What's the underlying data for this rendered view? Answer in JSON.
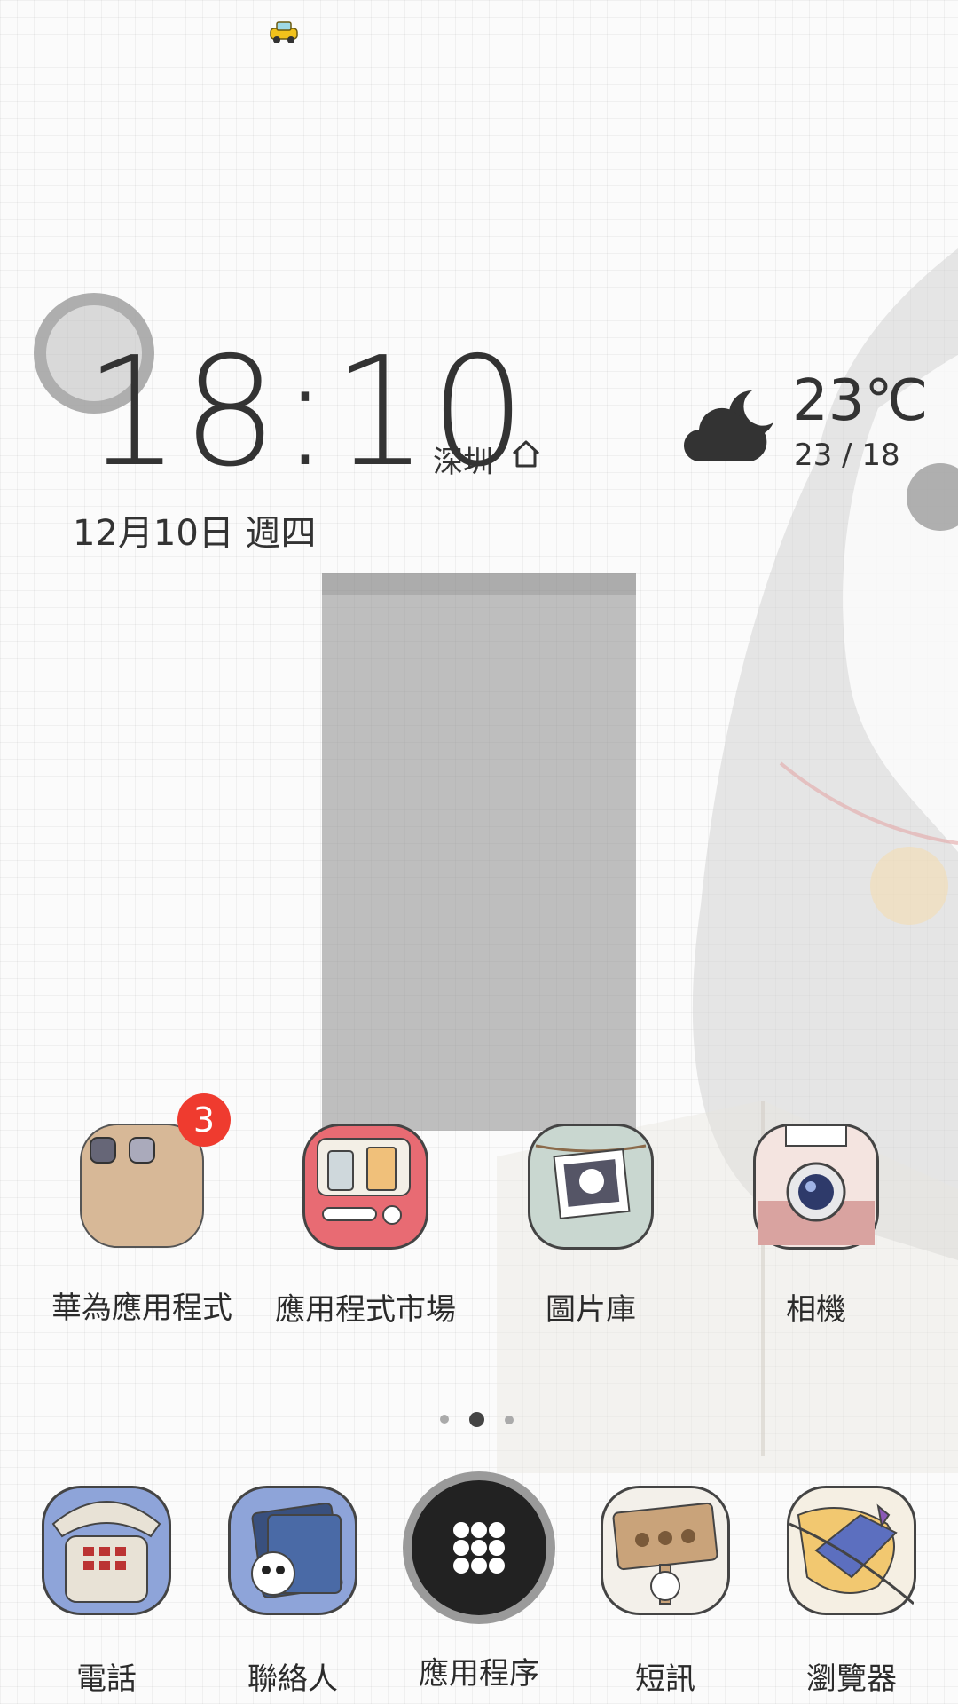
{
  "status_bar": {
    "notification_icon": "taxi-icon"
  },
  "clock": {
    "time": "18:10",
    "city": "深圳",
    "date": "12月10日 週四"
  },
  "weather": {
    "icon": "cloudy-night-icon",
    "temperature": "23℃",
    "range": "23 / 18"
  },
  "apps": [
    {
      "label": "華為應用程式",
      "icon": "folder-icon",
      "badge": "3"
    },
    {
      "label": "應用程式市場",
      "icon": "app-market-icon"
    },
    {
      "label": "圖片庫",
      "icon": "gallery-icon"
    },
    {
      "label": "相機",
      "icon": "camera-icon"
    }
  ],
  "page_indicator": {
    "pages": 3,
    "current": 2
  },
  "dock": [
    {
      "label": "電話",
      "icon": "phone-icon"
    },
    {
      "label": "聯絡人",
      "icon": "contacts-icon"
    },
    {
      "label": "應用程序",
      "icon": "app-drawer-icon"
    },
    {
      "label": "短訊",
      "icon": "messages-icon"
    },
    {
      "label": "瀏覽器",
      "icon": "browser-icon"
    }
  ],
  "colors": {
    "badge": "#ef3b2f",
    "text": "#2b2b2b"
  }
}
